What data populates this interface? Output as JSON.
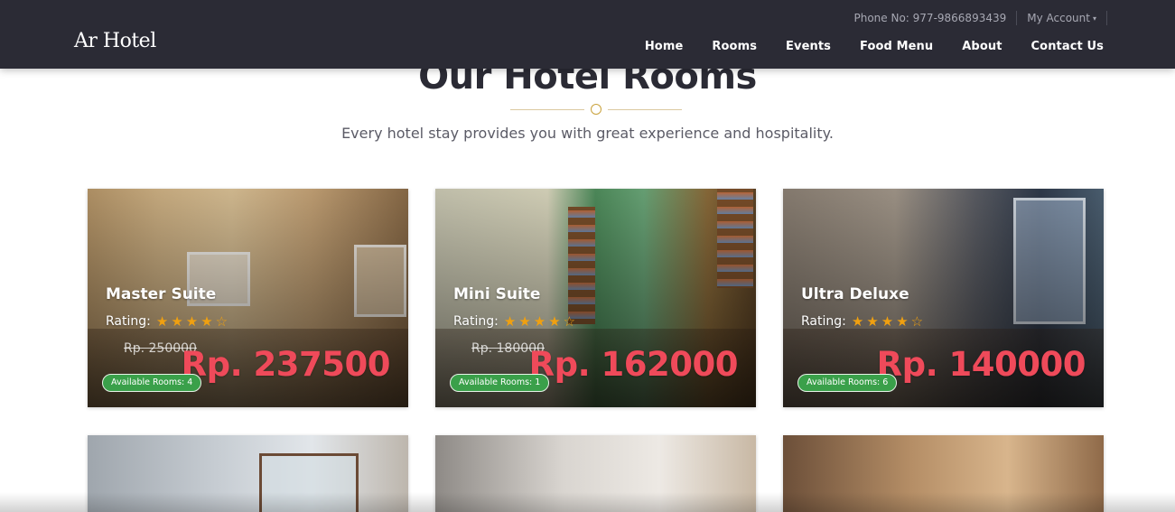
{
  "header": {
    "brand": "Ar Hotel",
    "phone": "Phone No: 977-9866893439",
    "account_label": "My Account",
    "nav": [
      {
        "label": "Home"
      },
      {
        "label": "Rooms"
      },
      {
        "label": "Events"
      },
      {
        "label": "Food Menu"
      },
      {
        "label": "About"
      },
      {
        "label": "Contact Us"
      }
    ]
  },
  "section": {
    "title": "Our Hotel Rooms",
    "subtitle": "Every hotel stay provides you with great experience and hospitality."
  },
  "rooms": [
    {
      "name": "Master Suite",
      "rating_label": "Rating:",
      "rating": 4,
      "rating_max": 5,
      "old_price": "Rp. 250000",
      "price": "Rp. 237500",
      "availability": "Available Rooms: 4"
    },
    {
      "name": "Mini Suite",
      "rating_label": "Rating:",
      "rating": 4,
      "rating_max": 5,
      "old_price": "Rp. 180000",
      "price": "Rp. 162000",
      "availability": "Available Rooms: 1"
    },
    {
      "name": "Ultra Deluxe",
      "rating_label": "Rating:",
      "rating": 4,
      "rating_max": 5,
      "old_price": "",
      "price": "Rp. 140000",
      "availability": "Available Rooms: 6"
    }
  ],
  "icons": {
    "star_filled": "★",
    "star_empty": "☆",
    "chevron": "⌄"
  },
  "colors": {
    "header_bg": "#2b2b35",
    "price": "#ef4a5a",
    "star": "#f0a010",
    "badge": "#3aa04a",
    "accent": "#c9a23c"
  }
}
